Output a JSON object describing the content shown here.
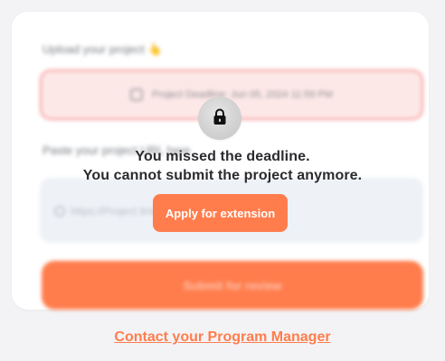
{
  "form": {
    "upload_label": "Upload your project",
    "upload_emoji": "👆",
    "deadline_text": "Project Deadline: Jun 05, 2024 11:59 PM",
    "paste_label": "Paste your project URL here",
    "url_placeholder": "https://Project link here",
    "submit_label": "Submit for review"
  },
  "overlay": {
    "lock_icon": "lock-icon",
    "message_line1": "You missed the deadline.",
    "message_line2": "You cannot submit the project anymore.",
    "apply_label": "Apply for extension"
  },
  "footer": {
    "contact_label": "Contact your Program Manager"
  },
  "colors": {
    "accent": "#ff7d4d",
    "deadline_bg": "#fde8e8",
    "deadline_border": "#f59a9a",
    "input_bg": "#eef1f6"
  }
}
